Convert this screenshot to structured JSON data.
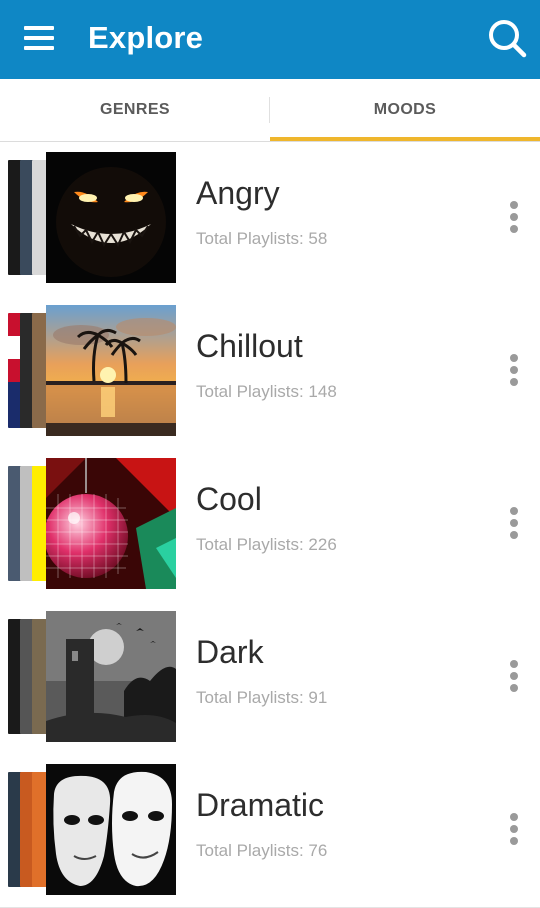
{
  "app_bar": {
    "title": "Explore",
    "menu_icon": "hamburger-menu-icon",
    "search_icon": "search-icon",
    "color": "#0f87c5"
  },
  "tabs": [
    {
      "label": "GENRES",
      "selected": false
    },
    {
      "label": "MOODS",
      "selected": true
    }
  ],
  "tab_indicator_color": "#efb62c",
  "moods": [
    {
      "name": "Angry",
      "count": "Total Playlists: 58",
      "more_icon": "more-vertical-icon"
    },
    {
      "name": "Chillout",
      "count": "Total Playlists: 148",
      "more_icon": "more-vertical-icon"
    },
    {
      "name": "Cool",
      "count": "Total Playlists: 226",
      "more_icon": "more-vertical-icon"
    },
    {
      "name": "Dark",
      "count": "Total Playlists: 91",
      "more_icon": "more-vertical-icon"
    },
    {
      "name": "Dramatic",
      "count": "Total Playlists: 76",
      "more_icon": "more-vertical-icon"
    }
  ]
}
